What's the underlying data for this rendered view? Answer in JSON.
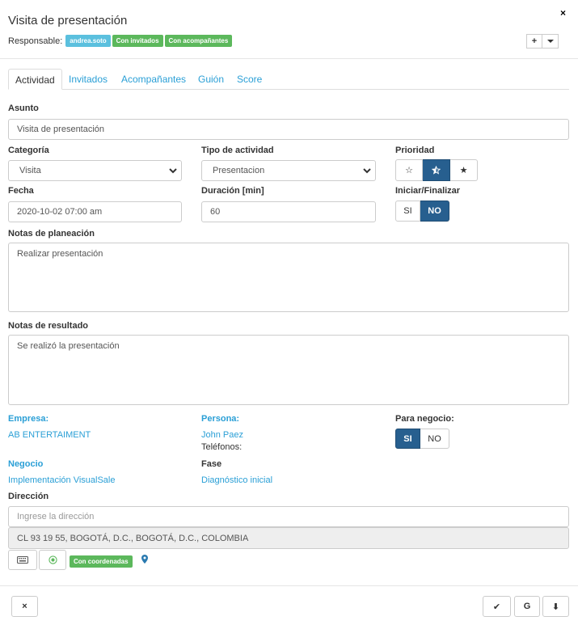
{
  "header": {
    "title": "Visita de presentación",
    "close_label": "×",
    "responsable_label": "Responsable:",
    "badges": [
      "andrea.soto",
      "Con invitados",
      "Con acompañantes"
    ],
    "add_label": "+"
  },
  "tabs": [
    {
      "label": "Actividad",
      "active": true
    },
    {
      "label": "Invitados",
      "active": false
    },
    {
      "label": "Acompañantes",
      "active": false
    },
    {
      "label": "Guión",
      "active": false
    },
    {
      "label": "Score",
      "active": false
    }
  ],
  "form": {
    "asunto_label": "Asunto",
    "asunto_value": "Visita de presentación",
    "categoria_label": "Categoría",
    "categoria_value": "Visita",
    "tipo_label": "Tipo de actividad",
    "tipo_value": "Presentacion",
    "prioridad_label": "Prioridad",
    "prioridad_selected": "medium",
    "fecha_label": "Fecha",
    "fecha_value": "2020-10-02 07:00 am",
    "duracion_label": "Duración [min]",
    "duracion_value": "60",
    "iniciar_label": "Iniciar/Finalizar",
    "iniciar_si": "SI",
    "iniciar_no": "NO",
    "iniciar_selected": "NO",
    "notas_plan_label": "Notas de planeación",
    "notas_plan_value": "Realizar presentación",
    "notas_res_label": "Notas de resultado",
    "notas_res_value": "Se realizó la presentación",
    "empresa_label": "Empresa:",
    "empresa_value": "AB ENTERTAIMENT",
    "persona_label": "Persona:",
    "persona_value": "John Paez",
    "telefonos_label": "Teléfonos:",
    "negocio_q_label": "Para negocio:",
    "negocio_si": "SI",
    "negocio_no": "NO",
    "negocio_selected": "SI",
    "negocio_label": "Negocio",
    "negocio_value": "Implementación VisualSale",
    "fase_label": "Fase",
    "fase_value": "Diagnóstico inicial",
    "direccion_label": "Dirección",
    "direccion_placeholder": "Ingrese la dirección",
    "direccion_value": "CL 93 19 55, BOGOTÁ, D.C., BOGOTÁ, D.C., COLOMBIA",
    "coords_badge": "Con coordenadas"
  },
  "footer": {
    "cancel_label": "×",
    "confirm_label": "✔",
    "google_label": "G",
    "download_label": "⬇"
  },
  "colors": {
    "accent": "#2a9fd6",
    "primary_active": "#275f8f",
    "badge_blue": "#5bc0de",
    "badge_green": "#5cb85c"
  }
}
